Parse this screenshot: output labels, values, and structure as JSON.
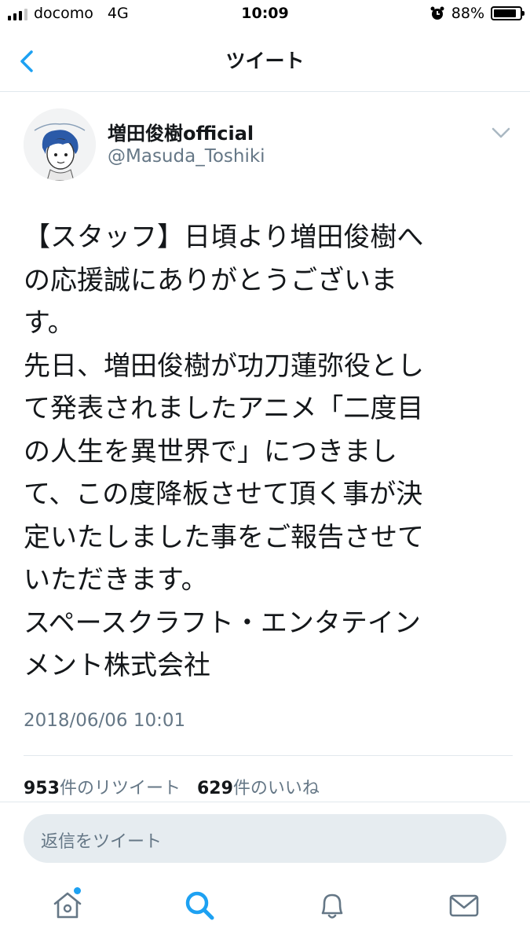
{
  "status_bar": {
    "carrier": "docomo",
    "network": "4G",
    "time": "10:09",
    "battery_percent": "88%",
    "battery_level": 0.88
  },
  "nav": {
    "title": "ツイート"
  },
  "tweet": {
    "display_name": "増田俊樹official",
    "handle": "@Masuda_Toshiki",
    "lines": [
      "【スタッフ】日頃より増田俊樹へ",
      "の応援誠にありがとうございま",
      "す。",
      "先日、増田俊樹が功刀蓮弥役とし",
      "て発表されましたアニメ「二度目",
      "の人生を異世界で」につきまし",
      "て、この度降板させて頂く事が決",
      "定いたしました事をご報告させて",
      "いただきます。",
      "スペースクラフト・エンタテイン",
      "メント株式会社"
    ],
    "timestamp": "2018/06/06 10:01",
    "retweet_count": "953",
    "retweet_label": "件のリツイート",
    "like_count": "629",
    "like_label": "件のいいね"
  },
  "reply": {
    "placeholder": "返信をツイート"
  },
  "tab_bar": {
    "tabs": [
      "home-icon",
      "search-icon",
      "bell-icon",
      "mail-icon"
    ],
    "active": "search-icon",
    "accent": "#1da1f2"
  },
  "colors": {
    "accent": "#1da1f2",
    "secondary_text": "#657786",
    "primary_text": "#14171a"
  }
}
